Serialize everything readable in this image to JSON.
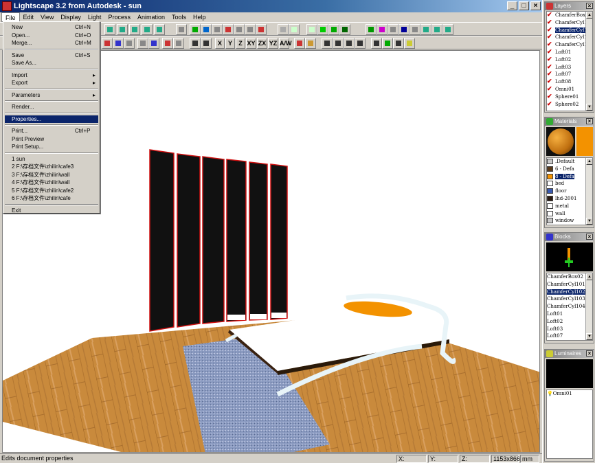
{
  "window": {
    "title": "Lightscape 3.2 from Autodesk - sun",
    "minimize": "_",
    "maximize": "□",
    "close": "×"
  },
  "menubar": [
    "File",
    "Edit",
    "View",
    "Display",
    "Light",
    "Process",
    "Animation",
    "Tools",
    "Help"
  ],
  "file_menu": [
    {
      "label": "New",
      "shortcut": "Ctrl+N"
    },
    {
      "label": "Open...",
      "shortcut": "Ctrl+O"
    },
    {
      "label": "Merge...",
      "shortcut": "Ctrl+M"
    },
    {
      "sep": true
    },
    {
      "label": "Save",
      "shortcut": "Ctrl+S"
    },
    {
      "label": "Save As...",
      "shortcut": ""
    },
    {
      "sep": true
    },
    {
      "label": "Import",
      "submenu": true
    },
    {
      "label": "Export",
      "submenu": true
    },
    {
      "sep": true
    },
    {
      "label": "Parameters",
      "submenu": true
    },
    {
      "sep": true
    },
    {
      "label": "Render...",
      "shortcut": ""
    },
    {
      "sep": true
    },
    {
      "label": "Properties...",
      "highlighted": true
    },
    {
      "sep": true
    },
    {
      "label": "Print...",
      "shortcut": "Ctrl+P"
    },
    {
      "label": "Print Preview",
      "shortcut": ""
    },
    {
      "label": "Print Setup...",
      "shortcut": ""
    },
    {
      "sep": true
    },
    {
      "label": "1 sun"
    },
    {
      "label": "2 F:\\存档文件\\zhilin\\cafe3"
    },
    {
      "label": "3 F:\\存档文件\\zhilin\\wall"
    },
    {
      "label": "4 F:\\存档文件\\zhilin\\wall"
    },
    {
      "label": "5 F:\\存档文件\\zhilin\\cafe2"
    },
    {
      "label": "6 F:\\存档文件\\zhilin\\cafe"
    },
    {
      "sep": true
    },
    {
      "label": "Exit"
    }
  ],
  "toolbar_axes": [
    "X",
    "Y",
    "Z",
    "XY",
    "ZX",
    "YZ",
    "A/W"
  ],
  "status": {
    "message": "Edits document properties",
    "x_label": "X:",
    "y_label": "Y:",
    "z_label": "Z:",
    "size": "1153x866",
    "units": "mm"
  },
  "layers": {
    "title": "Layers",
    "items": [
      {
        "label": "ChamferBox0",
        "checked": true,
        "selected": false
      },
      {
        "label": "ChamferCyl10",
        "checked": true,
        "selected": false
      },
      {
        "label": "ChamferCyl10",
        "checked": true,
        "selected": true
      },
      {
        "label": "ChamferCyl10",
        "checked": true,
        "selected": false
      },
      {
        "label": "ChamferCyl10",
        "checked": true,
        "selected": false
      },
      {
        "label": "Loft01",
        "checked": true,
        "selected": false
      },
      {
        "label": "Loft02",
        "checked": true,
        "selected": false
      },
      {
        "label": "Loft03",
        "checked": true,
        "selected": false
      },
      {
        "label": "Loft07",
        "checked": true,
        "selected": false
      },
      {
        "label": "Loft08",
        "checked": true,
        "selected": false
      },
      {
        "label": "Omni01",
        "checked": true,
        "selected": false
      },
      {
        "label": "Sphere01",
        "checked": true,
        "selected": false
      },
      {
        "label": "Sphere02",
        "checked": true,
        "selected": false
      }
    ]
  },
  "materials": {
    "title": "Materials",
    "preview_color": "#f39200",
    "items": [
      {
        "label": ".Default",
        "color": "#c8c8c8",
        "selected": false
      },
      {
        "label": "6 - Defa",
        "color": "#5a3a1a",
        "selected": false
      },
      {
        "label": "8 - Defa",
        "color": "#f39200",
        "selected": true
      },
      {
        "label": "bed",
        "color": "#ffffff",
        "selected": false
      },
      {
        "label": "floor",
        "color": "#3a5ab0",
        "selected": false
      },
      {
        "label": "lhd-2001",
        "color": "#2a1a10",
        "selected": false
      },
      {
        "label": "metal",
        "color": "#ffffff",
        "selected": false
      },
      {
        "label": "wall",
        "color": "#ffffff",
        "selected": false
      },
      {
        "label": "window",
        "color": "#c8c8c8",
        "selected": false
      }
    ]
  },
  "blocks": {
    "title": "Blocks",
    "items": [
      {
        "label": "ChamferBox02",
        "selected": false
      },
      {
        "label": "ChamferCyl101",
        "selected": false
      },
      {
        "label": "ChamferCyl102",
        "selected": true
      },
      {
        "label": "ChamferCyl103",
        "selected": false
      },
      {
        "label": "ChamferCyl104",
        "selected": false
      },
      {
        "label": "Loft01",
        "selected": false
      },
      {
        "label": "Loft02",
        "selected": false
      },
      {
        "label": "Loft03",
        "selected": false
      },
      {
        "label": "Loft07",
        "selected": false
      }
    ]
  },
  "luminaires": {
    "title": "Luminaires",
    "items": [
      {
        "label": "Omni01"
      }
    ]
  },
  "colors": {
    "titlebar": "#0a246a",
    "highlight": "#0a246a",
    "floor": "#c98a3c",
    "rug": "#8a9ac0",
    "pillow": "#f39200",
    "window": "#111111",
    "window_frame": "#d01010"
  }
}
